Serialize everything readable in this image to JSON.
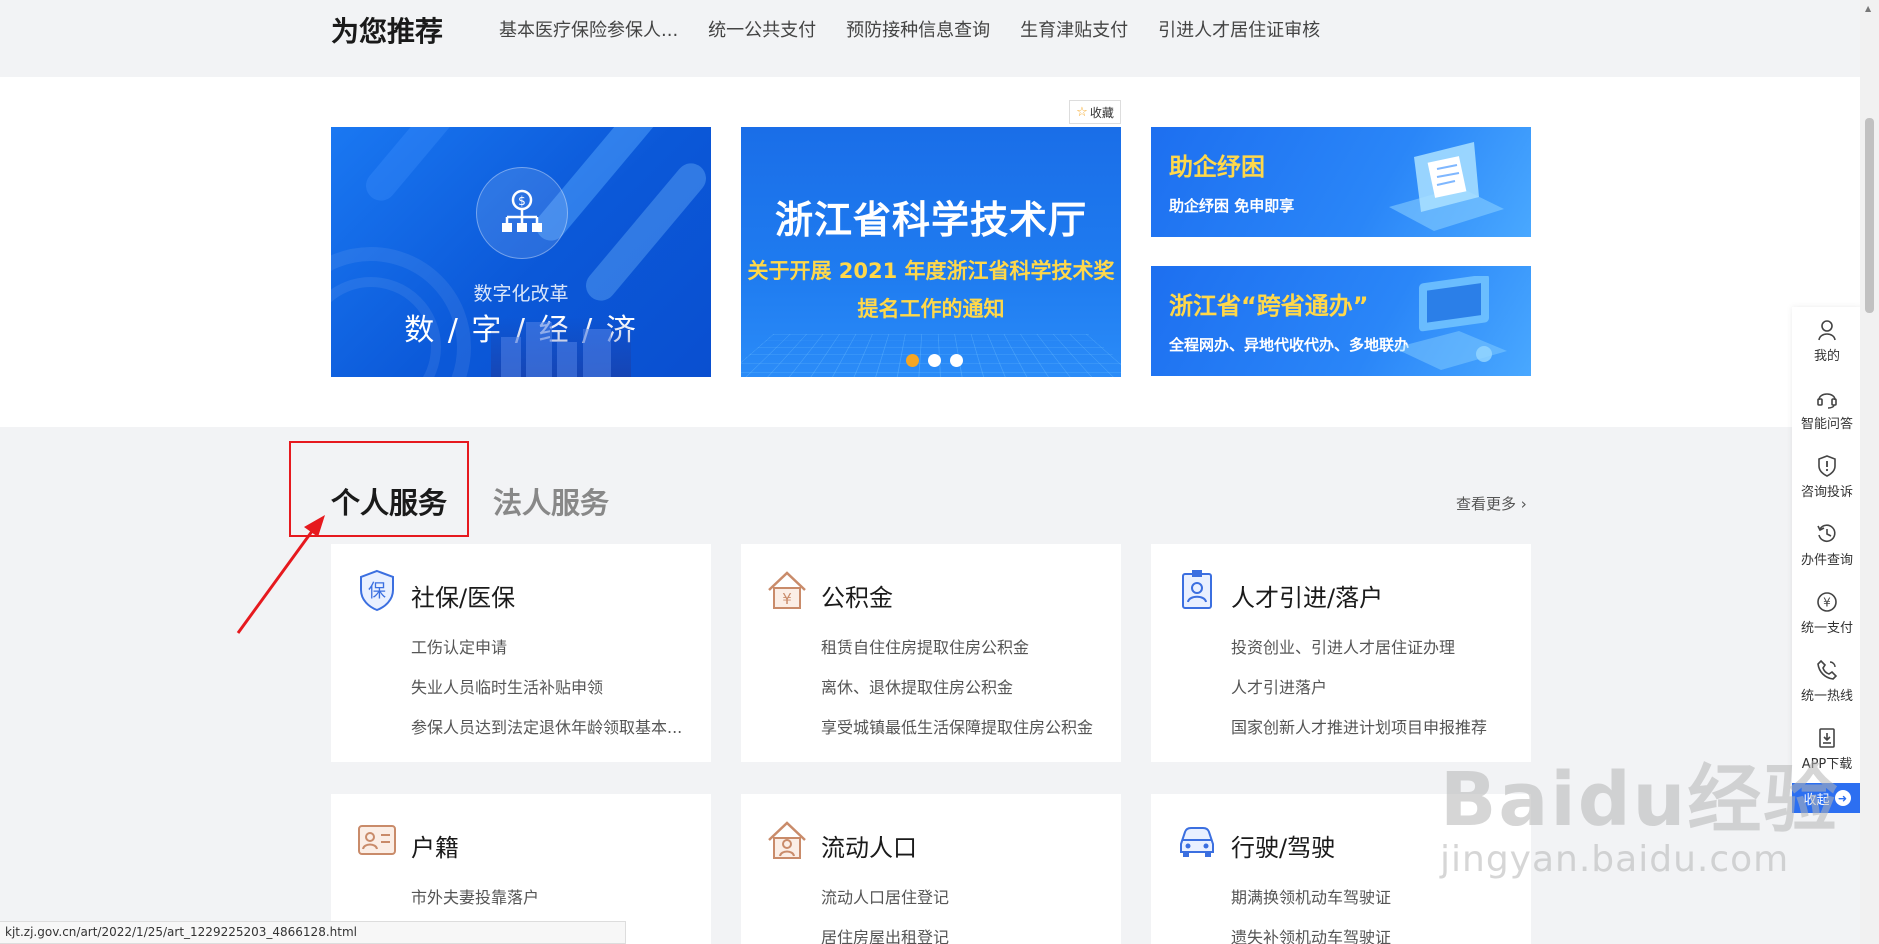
{
  "recommend": {
    "title": "为您推荐",
    "links": [
      "基本医疗保险参保人...",
      "统一公共支付",
      "预防接种信息查询",
      "生育津贴支付",
      "引进人才居住证审核"
    ]
  },
  "banners": {
    "favorite_label": "收藏",
    "b1": {
      "sub": "数字化改革",
      "main": "数 / 字 / 经 / 济"
    },
    "b2": {
      "title": "浙江省科学技术厅",
      "line1": "关于开展 2021 年度浙江省科学技术奖",
      "line2": "提名工作的通知"
    },
    "b3": {
      "title": "助企纾困",
      "subtitle": "助企纾困 免申即享"
    },
    "b4": {
      "title": "浙江省“跨省通办”",
      "subtitle": "全程网办、异地代收代办、多地联办"
    }
  },
  "services": {
    "tab_personal": "个人服务",
    "tab_corporate": "法人服务",
    "more": "查看更多",
    "cards": [
      {
        "title": "社保/医保",
        "icon": "insurance-shield-icon",
        "items": [
          "工伤认定申请",
          "失业人员临时生活补贴申领",
          "参保人员达到法定退休年龄领取基本..."
        ]
      },
      {
        "title": "公积金",
        "icon": "housing-fund-icon",
        "items": [
          "租赁自住住房提取住房公积金",
          "离休、退休提取住房公积金",
          "享受城镇最低生活保障提取住房公积金"
        ]
      },
      {
        "title": "人才引进/落户",
        "icon": "talent-id-icon",
        "items": [
          "投资创业、引进人才居住证办理",
          "人才引进落户",
          "国家创新人才推进计划项目申报推荐"
        ]
      },
      {
        "title": "户籍",
        "icon": "household-register-icon",
        "items": [
          "市外夫妻投靠落户"
        ]
      },
      {
        "title": "流动人口",
        "icon": "floating-population-icon",
        "items": [
          "流动人口居住登记",
          "居住房屋出租登记"
        ]
      },
      {
        "title": "行驶/驾驶",
        "icon": "car-icon",
        "items": [
          "期满换领机动车驾驶证",
          "遗失补领机动车驾驶证"
        ]
      }
    ]
  },
  "float_bar": {
    "items": [
      {
        "label": "我的",
        "icon": "user-icon"
      },
      {
        "label": "智能问答",
        "icon": "headset-icon"
      },
      {
        "label": "咨询投诉",
        "icon": "shield-alert-icon"
      },
      {
        "label": "办件查询",
        "icon": "history-icon"
      },
      {
        "label": "统一支付",
        "icon": "yuan-icon"
      },
      {
        "label": "统一热线",
        "icon": "phone-icon"
      },
      {
        "label": "APP下载",
        "icon": "download-icon"
      }
    ],
    "collapse": "收起"
  },
  "status_url": "kjt.zj.gov.cn/art/2022/1/25/art_1229225203_4866128.html",
  "watermark": {
    "logo": "Baidu经验",
    "sub": "jingyan.baidu.com"
  },
  "colors": {
    "accent": "#2c6ff1",
    "highlight": "#e6191e",
    "banner_yellow": "#ffd84a"
  }
}
